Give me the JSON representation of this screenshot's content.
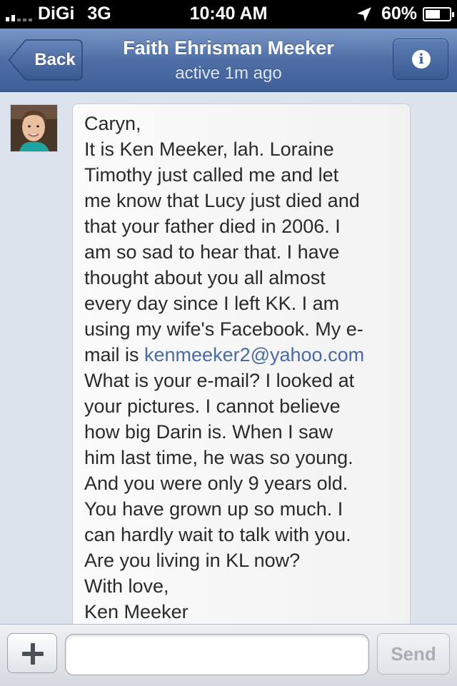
{
  "status_bar": {
    "carrier": "DiGi",
    "network": "3G",
    "time": "10:40 AM",
    "battery": "60%",
    "battery_level": 0.6,
    "signal_bars": 2
  },
  "nav": {
    "back_label": "Back",
    "title": "Faith Ehrisman Meeker",
    "subtitle": "active 1m ago",
    "info_icon_glyph": "i"
  },
  "message": {
    "lines": [
      "Caryn,",
      "It is Ken Meeker, lah. Loraine",
      "Timothy just called me and let",
      "me know that Lucy just died and",
      "that your father died in 2006. I",
      "am so sad to hear that. I have",
      "thought about you all almost",
      "every day since I left KK. I am",
      "using my wife's Facebook. My e-",
      "mail is ",
      "What is your e-mail? I looked at",
      "your pictures. I cannot believe",
      "how big Darin is. When I saw",
      "him last time, he was so young.",
      "And you were only 9 years old.",
      "You have grown up so much. I",
      "can hardly wait to talk with you.",
      "Are you living in KL now?",
      "With love,",
      "Ken Meeker"
    ],
    "email_link": "kenmeeker2@yahoo.com"
  },
  "composer": {
    "input_value": "",
    "send_label": "Send",
    "add_icon": "plus-icon"
  },
  "colors": {
    "nav_blue": "#4f6fa6",
    "link_blue": "#4b6aa3",
    "background": "#dde3ec"
  }
}
